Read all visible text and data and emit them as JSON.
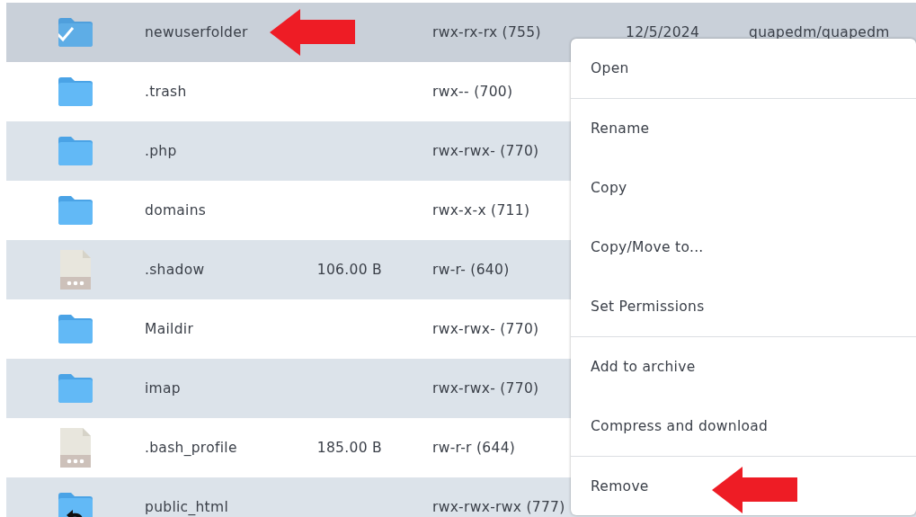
{
  "files": [
    {
      "kind": "folder",
      "name": "newuserfolder",
      "permissions": "rwx-rx-rx (755)",
      "date": "12/5/2024",
      "owner": "quapedm/quapedm",
      "selected": true,
      "annotated": true
    },
    {
      "kind": "folder",
      "name": ".trash",
      "permissions": "rwx-- (700)",
      "selected": false,
      "annotated": false
    },
    {
      "kind": "folder",
      "name": ".php",
      "permissions": "rwx-rwx- (770)",
      "selected": false,
      "annotated": false
    },
    {
      "kind": "folder",
      "name": "domains",
      "permissions": "rwx-x-x (711)",
      "selected": false,
      "annotated": false
    },
    {
      "kind": "file",
      "name": ".shadow",
      "size": "106.00 B",
      "permissions": "rw-r- (640)",
      "selected": false,
      "annotated": false
    },
    {
      "kind": "folder",
      "name": "Maildir",
      "permissions": "rwx-rwx- (770)",
      "selected": false,
      "annotated": false
    },
    {
      "kind": "folder",
      "name": "imap",
      "permissions": "rwx-rwx- (770)",
      "selected": false,
      "annotated": false
    },
    {
      "kind": "file",
      "name": ".bash_profile",
      "size": "185.00 B",
      "permissions": "rw-r-r (644)",
      "selected": false,
      "annotated": false
    },
    {
      "kind": "link",
      "name": "public_html",
      "permissions": "rwx-rwx-rwx (777)",
      "selected": false,
      "annotated": false
    }
  ],
  "context_menu": {
    "groups": [
      [
        {
          "label": "Open",
          "annotated": false
        }
      ],
      [
        {
          "label": "Rename",
          "annotated": false
        },
        {
          "label": "Copy",
          "annotated": false
        },
        {
          "label": "Copy/Move to...",
          "annotated": false
        },
        {
          "label": "Set Permissions",
          "annotated": false
        }
      ],
      [
        {
          "label": "Add to archive",
          "annotated": false
        },
        {
          "label": "Compress and download",
          "annotated": false
        }
      ],
      [
        {
          "label": "Remove",
          "annotated": true
        }
      ]
    ]
  }
}
